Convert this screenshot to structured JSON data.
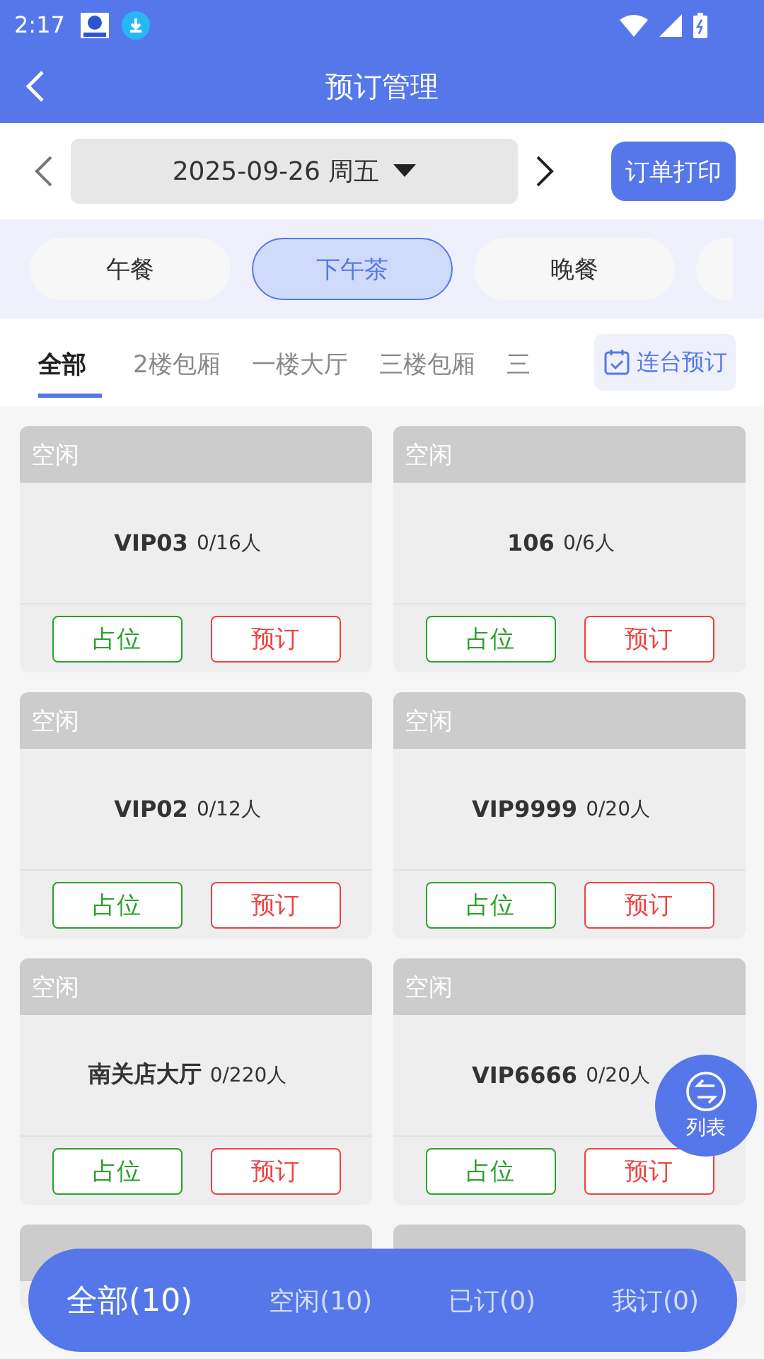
{
  "status_bar": {
    "time": "2:17"
  },
  "header": {
    "title": "预订管理"
  },
  "date_bar": {
    "date": "2025-09-26 周五",
    "print_button": "订单打印"
  },
  "meal_tabs": [
    {
      "label": "午餐",
      "selected": false
    },
    {
      "label": "下午茶",
      "selected": true
    },
    {
      "label": "晚餐",
      "selected": false
    }
  ],
  "area_tabs": [
    {
      "label": "全部",
      "selected": true
    },
    {
      "label": "2楼包厢",
      "selected": false
    },
    {
      "label": "一楼大厅",
      "selected": false
    },
    {
      "label": "三楼包厢",
      "selected": false
    },
    {
      "label": "三",
      "selected": false
    }
  ],
  "combine_button": "连台预订",
  "tables": [
    {
      "status": "空闲",
      "name": "VIP03",
      "capacity": "0/16人",
      "occupy": "占位",
      "reserve": "预订"
    },
    {
      "status": "空闲",
      "name": "106",
      "capacity": "0/6人",
      "occupy": "占位",
      "reserve": "预订"
    },
    {
      "status": "空闲",
      "name": "VIP02",
      "capacity": "0/12人",
      "occupy": "占位",
      "reserve": "预订"
    },
    {
      "status": "空闲",
      "name": "VIP9999",
      "capacity": "0/20人",
      "occupy": "占位",
      "reserve": "预订"
    },
    {
      "status": "空闲",
      "name": "南关店大厅",
      "capacity": "0/220人",
      "occupy": "占位",
      "reserve": "预订"
    },
    {
      "status": "空闲",
      "name": "VIP6666",
      "capacity": "0/20人",
      "occupy": "占位",
      "reserve": "预订"
    }
  ],
  "float_button": "列表",
  "filter_bar": [
    {
      "label": "全部(10)",
      "selected": true
    },
    {
      "label": "空闲(10)",
      "selected": false
    },
    {
      "label": "已订(0)",
      "selected": false
    },
    {
      "label": "我订(0)",
      "selected": false
    }
  ]
}
